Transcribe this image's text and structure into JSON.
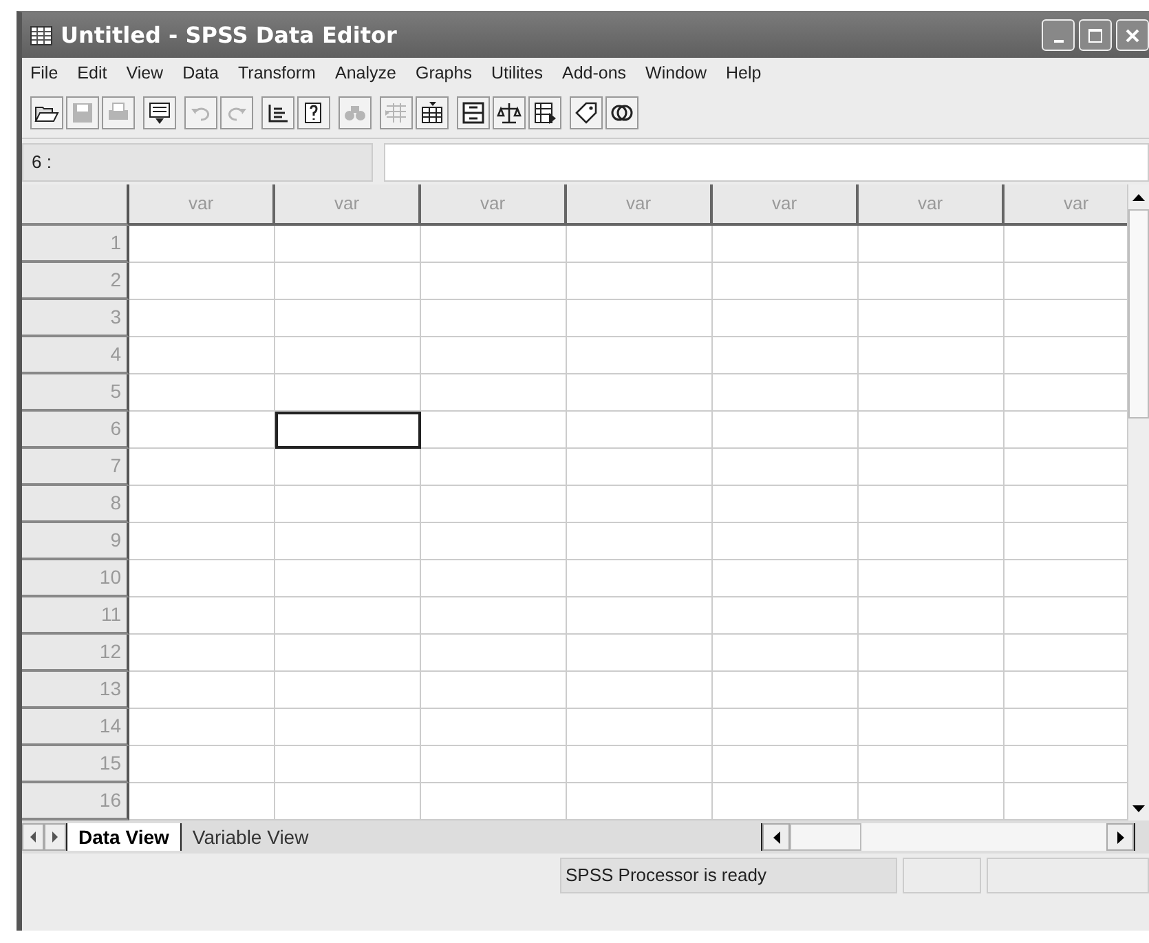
{
  "window": {
    "title": "Untitled - SPSS Data Editor"
  },
  "menu": [
    "File",
    "Edit",
    "View",
    "Data",
    "Transform",
    "Analyze",
    "Graphs",
    "Utilites",
    "Add-ons",
    "Window",
    "Help"
  ],
  "toolbar": [
    {
      "kind": "open",
      "disabled": false
    },
    {
      "kind": "save",
      "disabled": true
    },
    {
      "kind": "print",
      "disabled": true
    },
    {
      "kind": "dialog",
      "disabled": false
    },
    {
      "kind": "undo",
      "disabled": true
    },
    {
      "kind": "redo",
      "disabled": true
    },
    {
      "kind": "goto",
      "disabled": false
    },
    {
      "kind": "variables",
      "disabled": false
    },
    {
      "kind": "find",
      "disabled": true
    },
    {
      "kind": "insert-cases",
      "disabled": true
    },
    {
      "kind": "insert-variable",
      "disabled": false
    },
    {
      "kind": "split",
      "disabled": false
    },
    {
      "kind": "weight",
      "disabled": false
    },
    {
      "kind": "select",
      "disabled": false
    },
    {
      "kind": "labels",
      "disabled": false
    },
    {
      "kind": "sets",
      "disabled": false
    }
  ],
  "cell_editor": {
    "reference": "6 :"
  },
  "grid": {
    "columns": [
      "var",
      "var",
      "var",
      "var",
      "var",
      "var",
      "var"
    ],
    "rows": [
      {
        "number": "1",
        "cells": [
          {
            "selected": false
          },
          {
            "selected": false
          },
          {
            "selected": false
          },
          {
            "selected": false
          },
          {
            "selected": false
          },
          {
            "selected": false
          },
          {
            "selected": false
          }
        ]
      },
      {
        "number": "2",
        "cells": [
          {
            "selected": false
          },
          {
            "selected": false
          },
          {
            "selected": false
          },
          {
            "selected": false
          },
          {
            "selected": false
          },
          {
            "selected": false
          },
          {
            "selected": false
          }
        ]
      },
      {
        "number": "3",
        "cells": [
          {
            "selected": false
          },
          {
            "selected": false
          },
          {
            "selected": false
          },
          {
            "selected": false
          },
          {
            "selected": false
          },
          {
            "selected": false
          },
          {
            "selected": false
          }
        ]
      },
      {
        "number": "4",
        "cells": [
          {
            "selected": false
          },
          {
            "selected": false
          },
          {
            "selected": false
          },
          {
            "selected": false
          },
          {
            "selected": false
          },
          {
            "selected": false
          },
          {
            "selected": false
          }
        ]
      },
      {
        "number": "5",
        "cells": [
          {
            "selected": false
          },
          {
            "selected": false
          },
          {
            "selected": false
          },
          {
            "selected": false
          },
          {
            "selected": false
          },
          {
            "selected": false
          },
          {
            "selected": false
          }
        ]
      },
      {
        "number": "6",
        "cells": [
          {
            "selected": false
          },
          {
            "selected": true
          },
          {
            "selected": false
          },
          {
            "selected": false
          },
          {
            "selected": false
          },
          {
            "selected": false
          },
          {
            "selected": false
          }
        ]
      },
      {
        "number": "7",
        "cells": [
          {
            "selected": false
          },
          {
            "selected": false
          },
          {
            "selected": false
          },
          {
            "selected": false
          },
          {
            "selected": false
          },
          {
            "selected": false
          },
          {
            "selected": false
          }
        ]
      },
      {
        "number": "8",
        "cells": [
          {
            "selected": false
          },
          {
            "selected": false
          },
          {
            "selected": false
          },
          {
            "selected": false
          },
          {
            "selected": false
          },
          {
            "selected": false
          },
          {
            "selected": false
          }
        ]
      },
      {
        "number": "9",
        "cells": [
          {
            "selected": false
          },
          {
            "selected": false
          },
          {
            "selected": false
          },
          {
            "selected": false
          },
          {
            "selected": false
          },
          {
            "selected": false
          },
          {
            "selected": false
          }
        ]
      },
      {
        "number": "10",
        "cells": [
          {
            "selected": false
          },
          {
            "selected": false
          },
          {
            "selected": false
          },
          {
            "selected": false
          },
          {
            "selected": false
          },
          {
            "selected": false
          },
          {
            "selected": false
          }
        ]
      },
      {
        "number": "11",
        "cells": [
          {
            "selected": false
          },
          {
            "selected": false
          },
          {
            "selected": false
          },
          {
            "selected": false
          },
          {
            "selected": false
          },
          {
            "selected": false
          },
          {
            "selected": false
          }
        ]
      },
      {
        "number": "12",
        "cells": [
          {
            "selected": false
          },
          {
            "selected": false
          },
          {
            "selected": false
          },
          {
            "selected": false
          },
          {
            "selected": false
          },
          {
            "selected": false
          },
          {
            "selected": false
          }
        ]
      },
      {
        "number": "13",
        "cells": [
          {
            "selected": false
          },
          {
            "selected": false
          },
          {
            "selected": false
          },
          {
            "selected": false
          },
          {
            "selected": false
          },
          {
            "selected": false
          },
          {
            "selected": false
          }
        ]
      },
      {
        "number": "14",
        "cells": [
          {
            "selected": false
          },
          {
            "selected": false
          },
          {
            "selected": false
          },
          {
            "selected": false
          },
          {
            "selected": false
          },
          {
            "selected": false
          },
          {
            "selected": false
          }
        ]
      },
      {
        "number": "15",
        "cells": [
          {
            "selected": false
          },
          {
            "selected": false
          },
          {
            "selected": false
          },
          {
            "selected": false
          },
          {
            "selected": false
          },
          {
            "selected": false
          },
          {
            "selected": false
          }
        ]
      },
      {
        "number": "16",
        "cells": [
          {
            "selected": false
          },
          {
            "selected": false
          },
          {
            "selected": false
          },
          {
            "selected": false
          },
          {
            "selected": false
          },
          {
            "selected": false
          },
          {
            "selected": false
          }
        ]
      }
    ]
  },
  "tabs": [
    {
      "label": "Data View",
      "selected": true
    },
    {
      "label": "Variable View",
      "selected": false
    }
  ],
  "status_bar": {
    "message": "SPSS Processor is ready"
  }
}
